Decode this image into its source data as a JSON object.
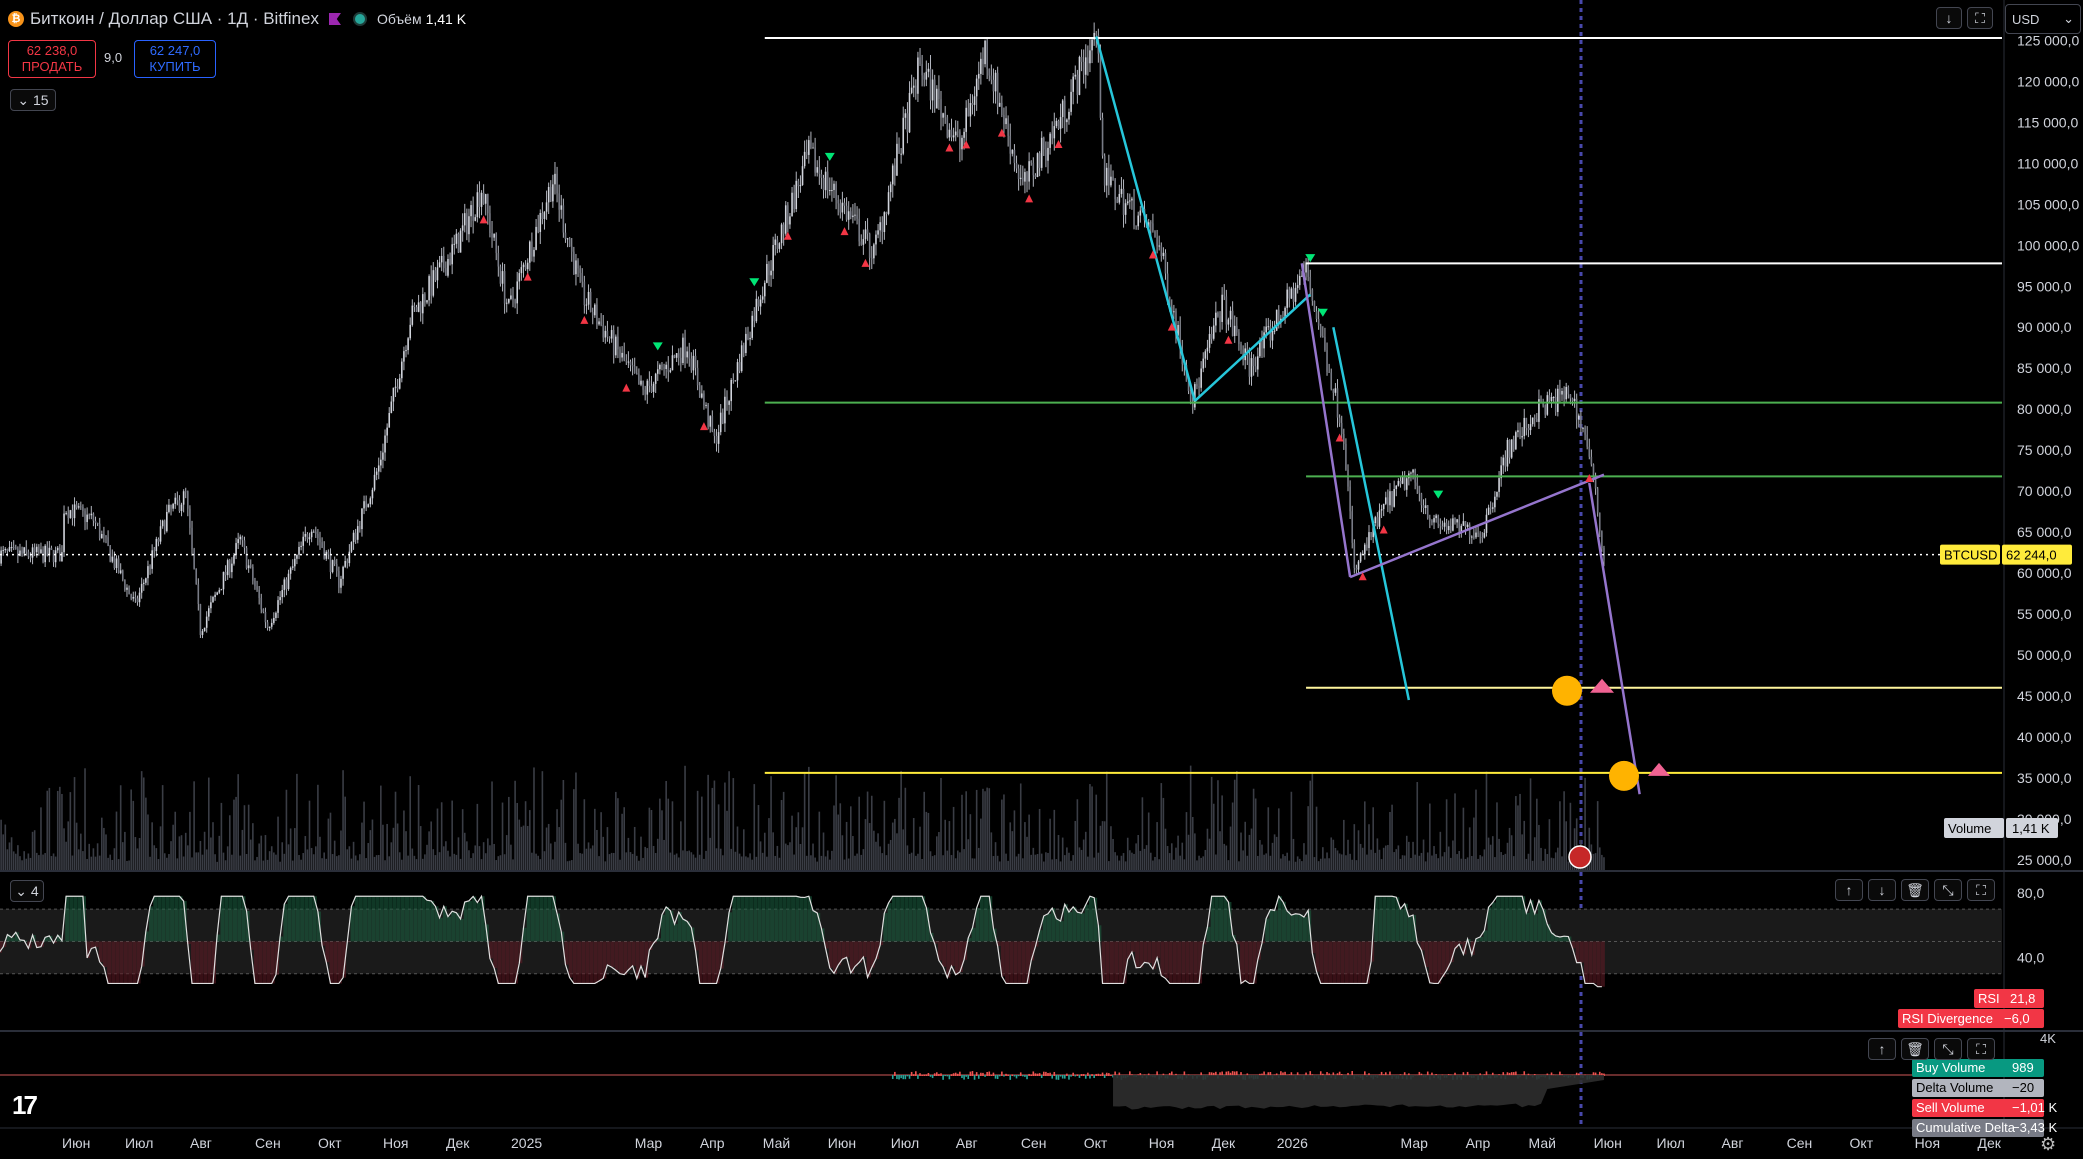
{
  "header": {
    "coin_icon": "bitcoin-icon",
    "coin_glyph": "₿",
    "title": "Биткоин / Доллар США · 1Д · Bitfinex",
    "volume_label": "Объём",
    "volume_value": "1,41 K",
    "sell_price": "62 238,0",
    "sell_label": "ПРОДАТЬ",
    "spread": "9,0",
    "buy_price": "62 247,0",
    "buy_label": "КУПИТЬ",
    "indicators_count": "15",
    "currency": "USD"
  },
  "colors": {
    "background": "#000000",
    "sell": "#f23645",
    "buy": "#2962ff",
    "rsi_label": "#f23645",
    "buy_volume": "#089981"
  },
  "chart_data": [
    {
      "type": "candlestick",
      "title": "Биткоин / Доллар США · 1Д · Bitfinex",
      "symbol": "BTCUSD",
      "last_price": 62244.0,
      "price_label": "62 244,0",
      "ylim": [
        25000,
        127500
      ],
      "y_ticks": [
        "125 000,0",
        "120 000,0",
        "115 000,0",
        "110 000,0",
        "105 000,0",
        "100 000,0",
        "95 000,0",
        "90 000,0",
        "85 000,0",
        "80 000,0",
        "75 000,0",
        "70 000,0",
        "65 000,0",
        "60 000,0",
        "55 000,0",
        "50 000,0",
        "45 000,0",
        "40 000,0",
        "35 000,0",
        "30 000,0",
        "25 000,0"
      ],
      "y_tick_values": [
        125000,
        120000,
        115000,
        110000,
        105000,
        100000,
        95000,
        90000,
        85000,
        80000,
        75000,
        70000,
        65000,
        60000,
        55000,
        50000,
        45000,
        40000,
        35000,
        30000,
        25000
      ],
      "x_ticks": [
        "Июн",
        "Июл",
        "Авг",
        "Сен",
        "Окт",
        "Ноя",
        "Дек",
        "2025",
        "Мар",
        "Апр",
        "Май",
        "Июн",
        "Июл",
        "Авг",
        "Сен",
        "Окт",
        "Ноя",
        "Дек",
        "2026",
        "Мар",
        "Апр",
        "Май",
        "Июн",
        "Июл",
        "Авг",
        "Сен",
        "Окт",
        "Ноя",
        "Дек"
      ],
      "price_path": [
        [
          "2024-06-01",
          68000
        ],
        [
          "2024-06-15",
          66500
        ],
        [
          "2024-07-05",
          56000
        ],
        [
          "2024-07-20",
          67000
        ],
        [
          "2024-07-29",
          69500
        ],
        [
          "2024-08-05",
          53000
        ],
        [
          "2024-08-24",
          64000
        ],
        [
          "2024-09-06",
          53500
        ],
        [
          "2024-09-27",
          66000
        ],
        [
          "2024-10-10",
          59000
        ],
        [
          "2024-10-29",
          73000
        ],
        [
          "2024-11-13",
          91000
        ],
        [
          "2024-12-05",
          100000
        ],
        [
          "2024-12-17",
          107000
        ],
        [
          "2024-12-30",
          92000
        ],
        [
          "2025-01-20",
          108000
        ],
        [
          "2025-02-03",
          94000
        ],
        [
          "2025-03-04",
          82000
        ],
        [
          "2025-03-25",
          88000
        ],
        [
          "2025-04-07",
          76000
        ],
        [
          "2025-05-01",
          96000
        ],
        [
          "2025-05-22",
          111000
        ],
        [
          "2025-06-22",
          99000
        ],
        [
          "2025-07-14",
          122000
        ],
        [
          "2025-08-02",
          112000
        ],
        [
          "2025-08-14",
          124000
        ],
        [
          "2025-09-01",
          107000
        ],
        [
          "2025-09-20",
          116000
        ],
        [
          "2025-10-06",
          126000
        ],
        [
          "2025-10-10",
          108000
        ],
        [
          "2025-11-04",
          101000
        ],
        [
          "2025-11-21",
          81000
        ],
        [
          "2025-12-05",
          93000
        ],
        [
          "2025-12-18",
          85000
        ],
        [
          "2026-01-14",
          97000
        ],
        [
          "2026-02-01",
          77000
        ],
        [
          "2026-02-06",
          60000
        ],
        [
          "2026-02-20",
          68000
        ],
        [
          "2026-03-05",
          72000
        ],
        [
          "2026-03-16",
          66000
        ],
        [
          "2026-04-08",
          65000
        ],
        [
          "2026-04-20",
          75000
        ],
        [
          "2026-05-05",
          80000
        ],
        [
          "2026-05-20",
          82000
        ],
        [
          "2026-05-28",
          76000
        ],
        [
          "2026-06-05",
          62244
        ]
      ],
      "horizontal_levels": [
        {
          "from": "2025-05-01",
          "price": 125300,
          "color": "#ffffff"
        },
        {
          "from": "2026-01-14",
          "price": 97800,
          "color": "#ffffff"
        },
        {
          "from": "2025-05-01",
          "price": 80800,
          "color": "#4caf50"
        },
        {
          "from": "2026-01-14",
          "price": 71800,
          "color": "#4caf50"
        },
        {
          "from": "2026-01-14",
          "price": 46000,
          "color": "#fff59d"
        },
        {
          "from": "2025-05-01",
          "price": 35600,
          "color": "#ffeb3b"
        }
      ],
      "trend_lines": [
        {
          "color": "#26c6da",
          "points": [
            [
              "2025-10-06",
              125500
            ],
            [
              "2025-11-22",
              81000
            ]
          ]
        },
        {
          "color": "#26c6da",
          "points": [
            [
              "2025-11-22",
              81000
            ],
            [
              "2026-01-16",
              94000
            ]
          ]
        },
        {
          "color": "#26c6da",
          "points": [
            [
              "2026-01-27",
              90000
            ],
            [
              "2026-03-04",
              44500
            ]
          ]
        },
        {
          "color": "#9575cd",
          "points": [
            [
              "2026-01-12",
              97800
            ],
            [
              "2026-02-04",
              59500
            ]
          ]
        },
        {
          "color": "#9575cd",
          "points": [
            [
              "2026-02-04",
              59500
            ],
            [
              "2026-06-05",
              72000
            ]
          ]
        },
        {
          "color": "#9575cd",
          "points": [
            [
              "2026-05-29",
              71000
            ],
            [
              "2026-06-22",
              33000
            ]
          ]
        }
      ],
      "volume_label": "Volume",
      "volume_value": "1,41 K",
      "indicator_count": "4",
      "events": [
        "thinking-face-icon",
        "exploding-head-icon",
        "us-flag-icon"
      ]
    },
    {
      "type": "line",
      "title": "RSI",
      "y_ticks": [
        "80,0",
        "40,0"
      ],
      "ylim": [
        20,
        90
      ],
      "bands": [
        70,
        50,
        30
      ],
      "rsi_label": "RSI",
      "rsi_value": "21,8",
      "divergence_label": "RSI Divergence",
      "divergence_value": "−6,0"
    },
    {
      "type": "area",
      "title": "Delta Volume",
      "y_ticks": [
        "4K"
      ],
      "series": [
        {
          "name": "Buy Volume",
          "value": "989"
        },
        {
          "name": "Delta Volume",
          "value": "−20"
        },
        {
          "name": "Sell Volume",
          "value": "−1,01 K"
        },
        {
          "name": "Cumulative Delta",
          "value": "−3,43 K"
        }
      ]
    }
  ]
}
